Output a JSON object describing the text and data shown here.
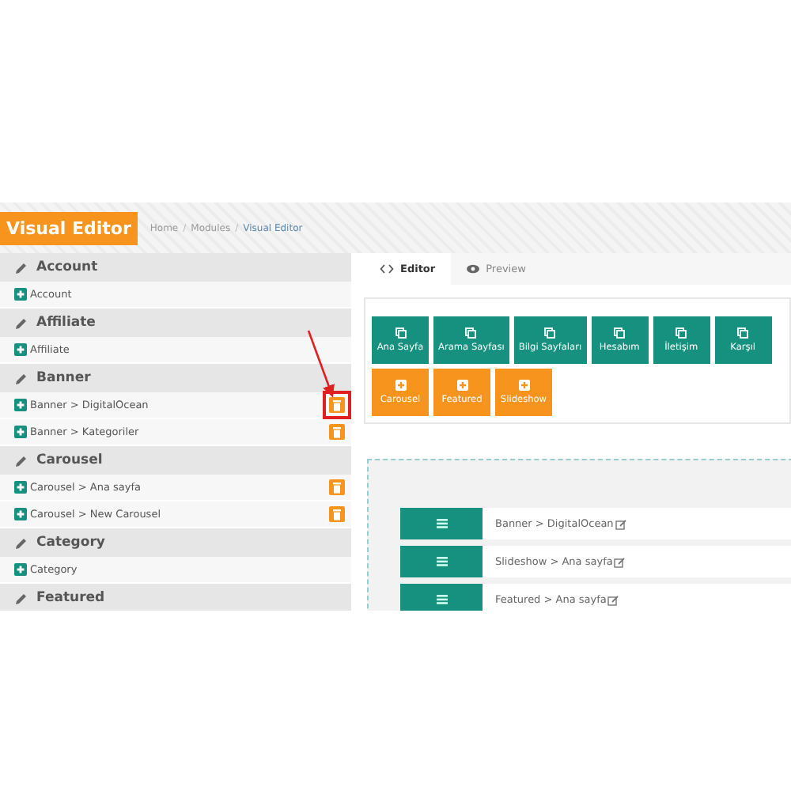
{
  "header": {
    "title": "Visual Editor",
    "separator": "/",
    "breadcrumb": [
      "Home",
      "Modules",
      "Visual Editor"
    ]
  },
  "sidebar": {
    "groups": [
      {
        "title": "Account",
        "items": [
          {
            "label": "Account",
            "deletable": false
          }
        ]
      },
      {
        "title": "Affiliate",
        "items": [
          {
            "label": "Affiliate",
            "deletable": false
          }
        ]
      },
      {
        "title": "Banner",
        "items": [
          {
            "label": "Banner > DigitalOcean",
            "deletable": true,
            "highlighted": true
          },
          {
            "label": "Banner > Kategoriler",
            "deletable": true,
            "highlighted": false
          }
        ]
      },
      {
        "title": "Carousel",
        "items": [
          {
            "label": "Carousel > Ana sayfa",
            "deletable": true,
            "highlighted": false
          },
          {
            "label": "Carousel > New Carousel",
            "deletable": true,
            "highlighted": false
          }
        ]
      },
      {
        "title": "Category",
        "items": [
          {
            "label": "Category",
            "deletable": false
          }
        ]
      },
      {
        "title": "Featured"
      }
    ]
  },
  "tabs": [
    {
      "label": "Editor",
      "selected": true
    },
    {
      "label": "Preview",
      "selected": false
    }
  ],
  "button_rows": [
    [
      {
        "label": "Ana Sayfa",
        "kind": "layout"
      },
      {
        "label": "Arama Sayfası",
        "kind": "layout"
      },
      {
        "label": "Bilgi Sayfaları",
        "kind": "layout"
      },
      {
        "label": "Hesabım",
        "kind": "layout"
      },
      {
        "label": "İletişim",
        "kind": "layout"
      },
      {
        "label": "Karşıl",
        "kind": "layout"
      }
    ],
    [
      {
        "label": "Carousel",
        "kind": "module"
      },
      {
        "label": "Featured",
        "kind": "module"
      },
      {
        "label": "Slideshow",
        "kind": "module"
      }
    ]
  ],
  "layout_rows": [
    {
      "label": "Banner > DigitalOcean"
    },
    {
      "label": "Slideshow > Ana sayfa"
    },
    {
      "label": "Featured > Ana sayfa"
    }
  ]
}
